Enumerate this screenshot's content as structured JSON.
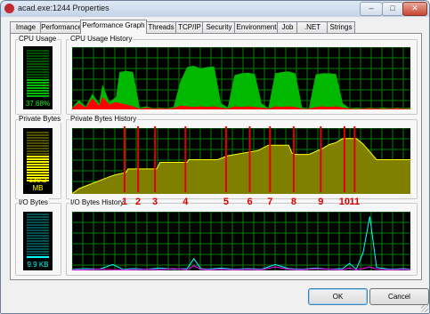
{
  "window": {
    "title": "acad.exe:1244 Properties"
  },
  "titlebar_buttons": {
    "minimize": "–",
    "maximize": "□",
    "close": "✕"
  },
  "tabs": [
    "Image",
    "Performance",
    "Performance Graph",
    "Threads",
    "TCP/IP",
    "Security",
    "Environment",
    "Job",
    ".NET",
    "Strings"
  ],
  "active_tab": "Performance Graph",
  "sections": {
    "cpu": {
      "label": "CPU Usage",
      "history_label": "CPU Usage History",
      "value": "37.68%"
    },
    "private_bytes": {
      "label": "Private Bytes",
      "history_label": "Private Bytes History",
      "value": "139.2 MB"
    },
    "io_bytes": {
      "label": "I/O Bytes",
      "history_label": "I/O Bytes History",
      "value": "9.9  KB"
    }
  },
  "annotations": [
    "1",
    "2",
    "3",
    "4",
    "5",
    "6",
    "7",
    "8",
    "9",
    "10",
    "11"
  ],
  "buttons": {
    "ok": "OK",
    "cancel": "Cancel"
  },
  "colors": {
    "graph_bg": "#000000",
    "grid": "#008000",
    "cpu_kernel": "#ff0000",
    "cpu_total": "#00b800",
    "memory_fill": "#808000",
    "memory_line": "#ffff00",
    "io_read": "#00ffff",
    "io_other": "#ff00ff",
    "annotation_marker": "#e00000"
  },
  "chart_data": [
    {
      "type": "area",
      "title": "CPU Usage History",
      "xlabel": "",
      "ylabel": "",
      "ylim": [
        0,
        100
      ],
      "x": [
        0,
        2,
        4,
        6,
        8,
        9,
        11,
        13,
        14,
        16,
        18,
        20,
        22,
        24,
        26,
        28,
        30,
        32,
        34,
        36,
        38,
        40,
        42,
        44,
        46,
        48,
        50,
        52,
        54,
        56,
        58,
        60,
        62,
        64,
        66,
        68,
        70,
        72,
        74,
        76,
        78,
        80,
        82,
        84,
        86,
        88,
        90,
        92,
        94,
        96,
        98,
        100
      ],
      "series": [
        {
          "name": "",
          "values": [
            3,
            15,
            5,
            25,
            10,
            40,
            12,
            20,
            60,
            62,
            60,
            3,
            5,
            2,
            3,
            2,
            4,
            45,
            68,
            70,
            66,
            68,
            69,
            10,
            3,
            55,
            58,
            59,
            57,
            10,
            2,
            58,
            60,
            61,
            58,
            3,
            2,
            56,
            58,
            58,
            57,
            10,
            2,
            3,
            2,
            3,
            2,
            3,
            2,
            3,
            2,
            3
          ]
        },
        {
          "name": "",
          "values": [
            2,
            10,
            3,
            18,
            6,
            20,
            8,
            12,
            10,
            8,
            5,
            1,
            3,
            1,
            2,
            1,
            2,
            6,
            5,
            4,
            5,
            4,
            5,
            3,
            1,
            5,
            4,
            5,
            4,
            3,
            1,
            5,
            4,
            5,
            4,
            1,
            1,
            4,
            5,
            4,
            5,
            3,
            1,
            1,
            1,
            2,
            1,
            1,
            1,
            2,
            1,
            1
          ]
        }
      ]
    },
    {
      "type": "area",
      "title": "Private Bytes History",
      "xlabel": "",
      "ylabel": "",
      "ylim": [
        0,
        100
      ],
      "x": [
        0,
        2,
        8,
        12,
        16,
        16.5,
        25,
        26,
        34,
        34.5,
        43,
        46,
        55,
        58,
        64,
        65,
        66,
        70,
        74,
        76,
        78,
        80,
        84,
        86,
        90,
        100
      ],
      "series": [
        {
          "name": "",
          "values": [
            0,
            8,
            20,
            28,
            33,
            38,
            38,
            48,
            48,
            52,
            52,
            58,
            66,
            74,
            74,
            62,
            60,
            60,
            69,
            75,
            78,
            84,
            84,
            76,
            52,
            52
          ]
        }
      ],
      "annotation_positions_x": [
        15.5,
        19.5,
        24.5,
        33.5,
        45.5,
        52.5,
        58.5,
        65.5,
        73.5,
        80.5,
        83.5
      ]
    },
    {
      "type": "line",
      "title": "I/O Bytes History",
      "xlabel": "",
      "ylabel": "",
      "ylim": [
        0,
        100
      ],
      "x": [
        0,
        4,
        8,
        12,
        15,
        18,
        22,
        26,
        30,
        34,
        36,
        38,
        40,
        44,
        48,
        52,
        56,
        60,
        64,
        68,
        72,
        76,
        80,
        82,
        84,
        86,
        88,
        90,
        94,
        98,
        100
      ],
      "series": [
        {
          "name": "",
          "values": [
            2,
            3,
            2,
            10,
            2,
            3,
            2,
            4,
            2,
            3,
            20,
            3,
            2,
            4,
            2,
            3,
            2,
            10,
            3,
            2,
            4,
            2,
            3,
            12,
            2,
            30,
            92,
            5,
            2,
            3,
            2
          ]
        },
        {
          "name": "",
          "values": [
            1,
            1,
            2,
            1,
            1,
            1,
            2,
            1,
            3,
            1,
            8,
            2,
            1,
            2,
            1,
            2,
            1,
            6,
            2,
            1,
            3,
            2,
            1,
            4,
            1,
            3,
            6,
            2,
            1,
            2,
            1
          ]
        }
      ]
    }
  ]
}
